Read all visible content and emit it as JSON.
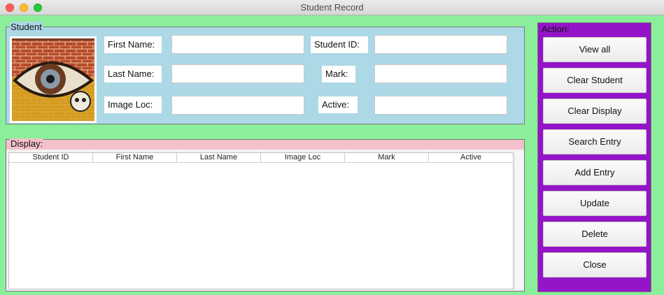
{
  "window": {
    "title": "Student Record"
  },
  "student": {
    "legend": "Student",
    "fields": {
      "first_name": {
        "label": "First Name:",
        "value": ""
      },
      "last_name": {
        "label": "Last Name:",
        "value": ""
      },
      "image_loc": {
        "label": "Image Loc:",
        "value": ""
      },
      "student_id": {
        "label": "Student ID:",
        "value": ""
      },
      "mark": {
        "label": "Mark:",
        "value": ""
      },
      "active": {
        "label": "Active:",
        "value": ""
      }
    }
  },
  "display": {
    "legend": "Display:",
    "columns": [
      "Student ID",
      "First Name",
      "Last Name",
      "Image Loc",
      "Mark",
      "Active"
    ],
    "rows": []
  },
  "action": {
    "legend": "Action:",
    "buttons": [
      "View all",
      "Clear Student",
      "Clear Display",
      "Search Entry",
      "Add Entry",
      "Update",
      "Delete",
      "Close"
    ]
  },
  "colors": {
    "window_bg": "#8bee9a",
    "student_bg": "#add8e6",
    "display_legend_bg": "#f4c1cb",
    "action_bg": "#9414c8"
  }
}
